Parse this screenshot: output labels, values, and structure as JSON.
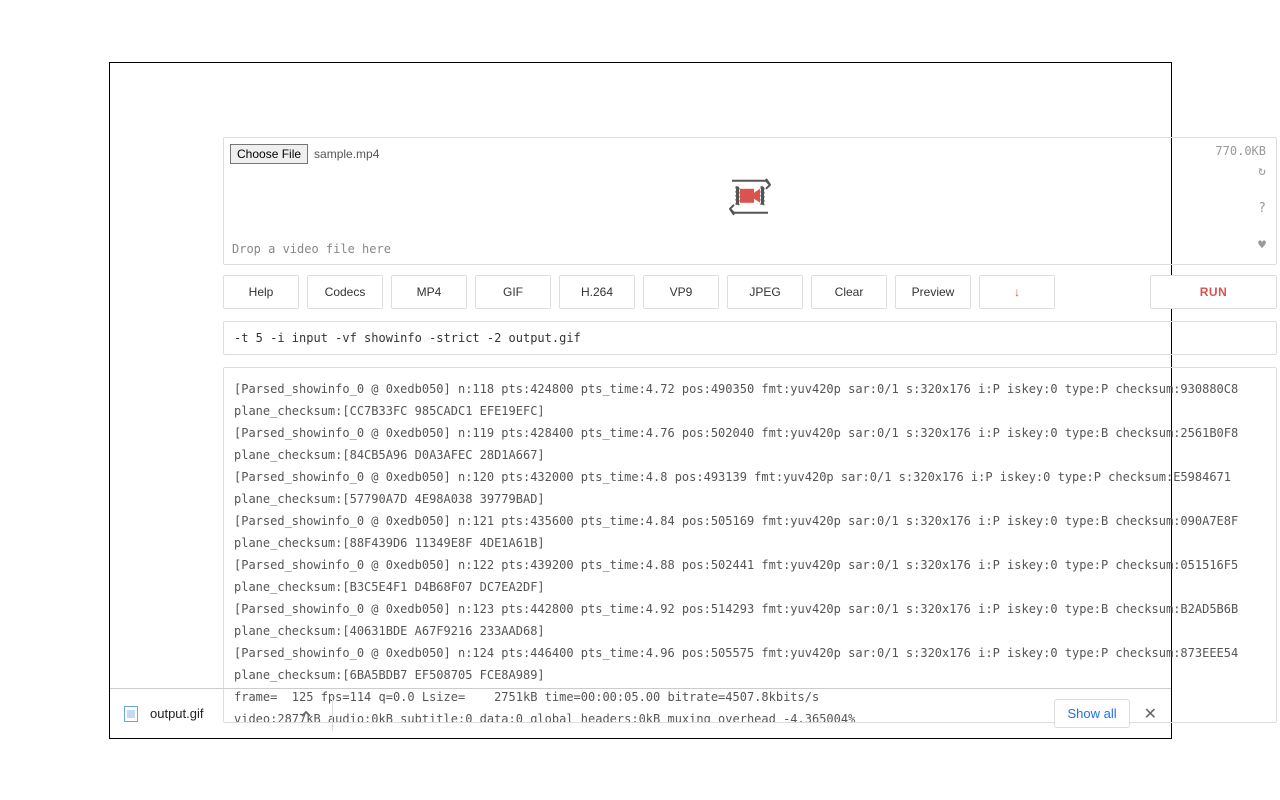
{
  "file": {
    "choose_label": "Choose File",
    "name": "sample.mp4",
    "size": "770.0KB",
    "drop_hint": "Drop a video file here"
  },
  "side_icons": {
    "reload": "↻",
    "help": "?",
    "heart": "♥"
  },
  "toolbar": {
    "help": "Help",
    "codecs": "Codecs",
    "mp4": "MP4",
    "gif": "GIF",
    "h264": "H.264",
    "vp9": "VP9",
    "jpeg": "JPEG",
    "clear": "Clear",
    "preview": "Preview",
    "download_arrow": "↓",
    "run": "RUN"
  },
  "command": "-t 5 -i input -vf showinfo -strict -2 output.gif",
  "log": "[Parsed_showinfo_0 @ 0xedb050] n:118 pts:424800 pts_time:4.72 pos:490350 fmt:yuv420p sar:0/1 s:320x176 i:P iskey:0 type:P checksum:930880C8 plane_checksum:[CC7B33FC 985CADC1 EFE19EFC]\n[Parsed_showinfo_0 @ 0xedb050] n:119 pts:428400 pts_time:4.76 pos:502040 fmt:yuv420p sar:0/1 s:320x176 i:P iskey:0 type:B checksum:2561B0F8 plane_checksum:[84CB5A96 D0A3AFEC 28D1A667]\n[Parsed_showinfo_0 @ 0xedb050] n:120 pts:432000 pts_time:4.8 pos:493139 fmt:yuv420p sar:0/1 s:320x176 i:P iskey:0 type:P checksum:E5984671 plane_checksum:[57790A7D 4E98A038 39779BAD]\n[Parsed_showinfo_0 @ 0xedb050] n:121 pts:435600 pts_time:4.84 pos:505169 fmt:yuv420p sar:0/1 s:320x176 i:P iskey:0 type:B checksum:090A7E8F plane_checksum:[88F439D6 11349E8F 4DE1A61B]\n[Parsed_showinfo_0 @ 0xedb050] n:122 pts:439200 pts_time:4.88 pos:502441 fmt:yuv420p sar:0/1 s:320x176 i:P iskey:0 type:P checksum:051516F5 plane_checksum:[B3C5E4F1 D4B68F07 DC7EA2DF]\n[Parsed_showinfo_0 @ 0xedb050] n:123 pts:442800 pts_time:4.92 pos:514293 fmt:yuv420p sar:0/1 s:320x176 i:P iskey:0 type:B checksum:B2AD5B6B plane_checksum:[40631BDE A67F9216 233AAD68]\n[Parsed_showinfo_0 @ 0xedb050] n:124 pts:446400 pts_time:4.96 pos:505575 fmt:yuv420p sar:0/1 s:320x176 i:P iskey:0 type:P checksum:873EEE54 plane_checksum:[6BA5BDB7 EF508705 FCE8A989]\nframe=  125 fps=114 q=0.0 Lsize=    2751kB time=00:00:05.00 bitrate=4507.8kbits/s\nvideo:2877kB audio:0kB subtitle:0 data:0 global headers:0kB muxing overhead -4.365004%",
  "download": {
    "filename": "output.gif",
    "show_all": "Show all"
  }
}
